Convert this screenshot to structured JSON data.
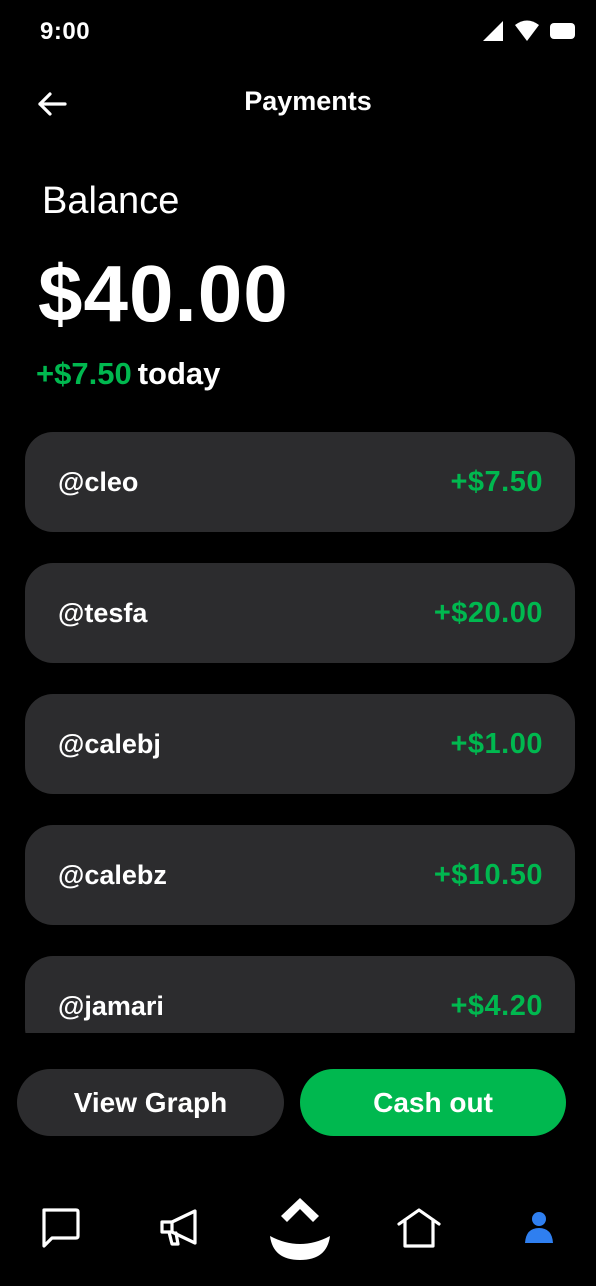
{
  "status_bar": {
    "time": "9:00"
  },
  "header": {
    "title": "Payments",
    "back_icon": "arrow-left-icon"
  },
  "balance": {
    "label": "Balance",
    "amount": "$40.00",
    "today_change": "+$7.50",
    "today_label": "today"
  },
  "payments": [
    {
      "user": "@cleo",
      "amount": "+$7.50"
    },
    {
      "user": "@tesfa",
      "amount": "+$20.00"
    },
    {
      "user": "@calebj",
      "amount": "+$1.00"
    },
    {
      "user": "@calebz",
      "amount": "+$10.50"
    },
    {
      "user": "@jamari",
      "amount": "+$4.20"
    }
  ],
  "actions": {
    "view_graph": "View Graph",
    "cash_out": "Cash out"
  },
  "nav": {
    "items": [
      "chat-icon",
      "megaphone-icon",
      "app-logo-icon",
      "home-icon",
      "profile-icon"
    ],
    "active": "profile-icon"
  },
  "colors": {
    "background": "#000000",
    "card": "#2c2c2e",
    "accent_green": "#00b84f",
    "active_blue": "#2f7ff0"
  }
}
